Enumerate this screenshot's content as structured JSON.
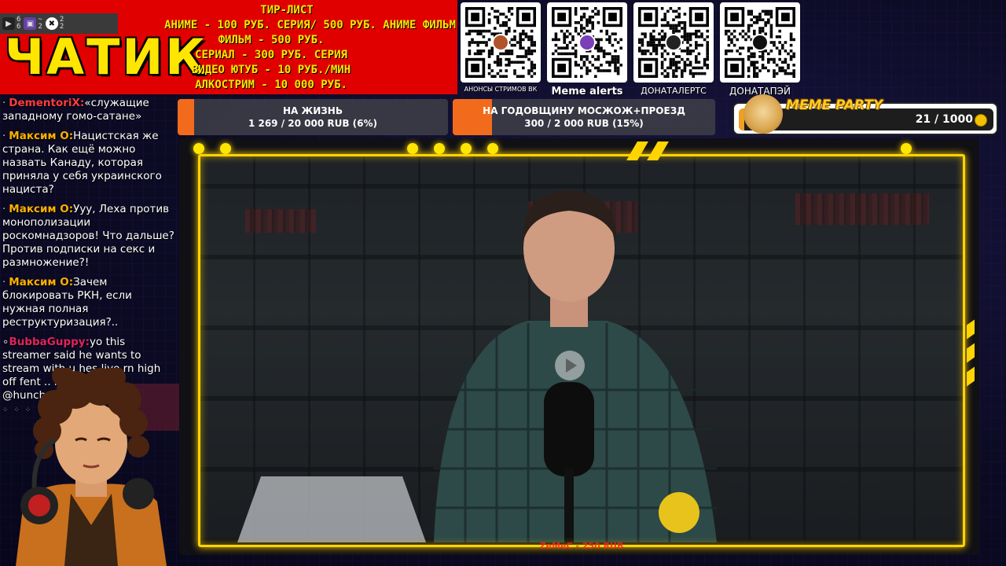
{
  "header": {
    "title": "ЧАТИК",
    "counters": [
      {
        "icon": "youtube-icon",
        "values": [
          "6",
          "6"
        ]
      },
      {
        "icon": "twitch-icon",
        "values": [
          "~",
          "2"
        ]
      },
      {
        "icon": "kick-icon",
        "values": [
          "2",
          "2"
        ]
      }
    ],
    "tier_list": {
      "heading": "ТИР-ЛИСТ",
      "lines": [
        "АНИМЕ - 100 РУБ. СЕРИЯ/ 500 РУБ. АНИМЕ ФИЛЬМ",
        "ФИЛЬМ - 500 РУБ.",
        "СЕРИАЛ - 300 РУБ. СЕРИЯ",
        "ВИДЕО ЮТУБ - 10 РУБ./МИН",
        "АЛКОСТРИМ - 10 000 РУБ."
      ]
    }
  },
  "qr_codes": [
    {
      "label": "АНОНСЫ СТРИМОВ ВК",
      "logo_color": "#b0522a"
    },
    {
      "label": "Meme alerts",
      "logo_color": "#7b3fb8"
    },
    {
      "label": "ДОНАТАЛЕРТС",
      "logo_color": "#222222"
    },
    {
      "label": "ДОНАТАПЭЙ",
      "logo_color": "#111111"
    }
  ],
  "chat": {
    "messages": [
      {
        "user": "DementoriX",
        "sep": ":",
        "text": "«служащие западному гомо-сатане»",
        "color": "#ff3b3b"
      },
      {
        "user": "Максим О",
        "sep": ":",
        "text": "Нацистская же страна. Как ещё можно назвать Канаду, которая приняла у себя украинского нациста?",
        "color": "#ffb000"
      },
      {
        "user": "Максим О",
        "sep": ":",
        "text": "Ууу, Леха против монополизации роскомнадзоров! Что дальше? Против подписки на секс и размножение?!",
        "color": "#ffb000"
      },
      {
        "user": "Максим О",
        "sep": ":",
        "text": "Зачем блокировать РКН, если нужная полная реструктуризация?..",
        "color": "#ffb000"
      },
      {
        "user": "BubbaGuppy",
        "sep": ":",
        "text": "yo this streamer said he wants to stream with u hes live rn high off fent .. his kick is: @hunchos007",
        "color": "#e0245e"
      }
    ]
  },
  "goals": [
    {
      "title": "НА ЖИЗНЬ",
      "progress_text": "1 269 / 20 000 RUB (6%)",
      "percent": 6
    },
    {
      "title": "НА ГОДОВЩИНУ МОСЖОЖ+ПРОЕЗД",
      "progress_text": "300 / 2 000 RUB (15%)",
      "percent": 15
    }
  ],
  "meme_party": {
    "title": "MEME PARTY",
    "count": "21 / 1000",
    "fraction": 0.021
  },
  "video": {
    "caption": "ZeMeC - 250 RUB"
  },
  "colors": {
    "accent_yellow": "#ffd400",
    "header_red": "#e00000",
    "goal_orange": "#f26b1d"
  }
}
